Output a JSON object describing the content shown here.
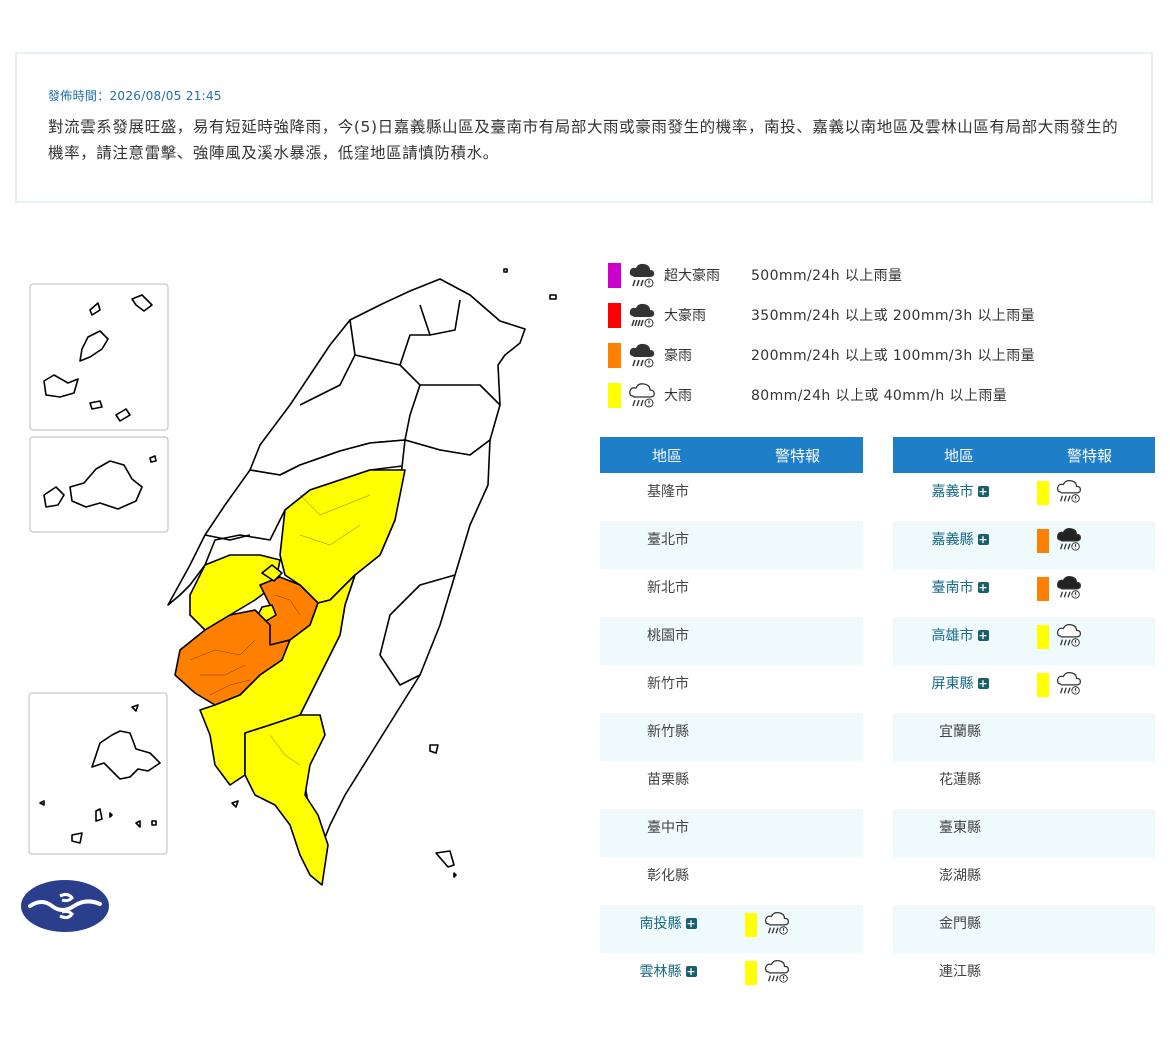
{
  "notice": {
    "pub_time": "發佈時間：2026/08/05 21:45",
    "description": "對流雲系發展旺盛，易有短延時強降雨，今(5)日嘉義縣山區及臺南市有局部大雨或豪雨發生的機率，南投、嘉義以南地區及雲林山區有局部大雨發生的機率，請注意雷擊、強陣風及溪水暴漲，低窪地區請慎防積水。"
  },
  "colors": {
    "extreme": "#cc00cc",
    "torrential": "#ff0000",
    "extremely_heavy": "#ff8000",
    "heavy": "#ffff00",
    "header": "#1f7ec8",
    "row_alt": "#eefafc"
  },
  "legend": [
    {
      "name": "超大豪雨",
      "desc": "500mm/24h 以上雨量",
      "color": "#cc00cc",
      "icon": "thunder-rain-icon"
    },
    {
      "name": "大豪雨",
      "desc": "350mm/24h 以上或 200mm/3h 以上雨量",
      "color": "#ff0000",
      "icon": "heavy-rain-icon"
    },
    {
      "name": "豪雨",
      "desc": "200mm/24h 以上或 100mm/3h 以上雨量",
      "color": "#ff8000",
      "icon": "heavy-rain-icon"
    },
    {
      "name": "大雨",
      "desc": "80mm/24h 以上或 40mm/h 以上雨量",
      "color": "#ffff00",
      "icon": "rain-outline-icon"
    }
  ],
  "table_headers": {
    "region": "地區",
    "alert": "警特報"
  },
  "table_left": [
    {
      "name": "基隆市",
      "level": ""
    },
    {
      "name": "臺北市",
      "level": ""
    },
    {
      "name": "新北市",
      "level": ""
    },
    {
      "name": "桃園市",
      "level": ""
    },
    {
      "name": "新竹市",
      "level": ""
    },
    {
      "name": "新竹縣",
      "level": ""
    },
    {
      "name": "苗栗縣",
      "level": ""
    },
    {
      "name": "臺中市",
      "level": ""
    },
    {
      "name": "彰化縣",
      "level": ""
    },
    {
      "name": "南投縣",
      "level": "heavy"
    },
    {
      "name": "雲林縣",
      "level": "heavy"
    }
  ],
  "table_right": [
    {
      "name": "嘉義市",
      "level": "heavy"
    },
    {
      "name": "嘉義縣",
      "level": "extremely_heavy"
    },
    {
      "name": "臺南市",
      "level": "extremely_heavy"
    },
    {
      "name": "高雄市",
      "level": "heavy"
    },
    {
      "name": "屏東縣",
      "level": "heavy"
    },
    {
      "name": "宜蘭縣",
      "level": ""
    },
    {
      "name": "花蓮縣",
      "level": ""
    },
    {
      "name": "臺東縣",
      "level": ""
    },
    {
      "name": "澎湖縣",
      "level": ""
    },
    {
      "name": "金門縣",
      "level": ""
    },
    {
      "name": "連江縣",
      "level": ""
    }
  ]
}
